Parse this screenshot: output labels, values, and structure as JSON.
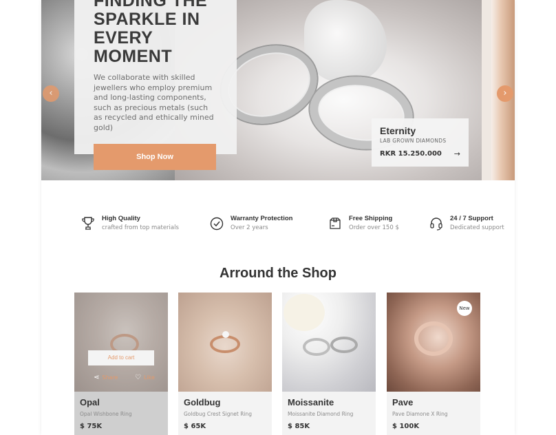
{
  "hero": {
    "title": "FINDING THE SPARKLE IN EVERY MOMENT",
    "description": "We collaborate with skilled jewellers who employ premium and long-lasting components, such as precious metals (such as recycled and ethically mined gold)",
    "shop_button": "Shop Now",
    "prev_arrow": "‹",
    "next_arrow": "›",
    "product": {
      "name": "Eternity",
      "subtitle": "LAB GROWN DIAMONDS",
      "price": "RKR 15.250.000",
      "arrow": "→"
    }
  },
  "features": [
    {
      "title": "High Quality",
      "subtitle": "crafted from top materials",
      "icon": "trophy-icon"
    },
    {
      "title": "Warranty Protection",
      "subtitle": "Over 2 years",
      "icon": "check-circle-icon"
    },
    {
      "title": "Free Shipping",
      "subtitle": "Order over 150 $",
      "icon": "shipping-box-icon"
    },
    {
      "title": "24 / 7 Support",
      "subtitle": "Dedicated support",
      "icon": "headset-icon"
    }
  ],
  "shop": {
    "title": "Arround the Shop",
    "add_to_cart": "Add to cart",
    "share": "Share",
    "like": "Like",
    "new_badge": "New",
    "products": [
      {
        "name": "Opal",
        "subtitle": "Opal Wishbone Ring",
        "price": "$ 75K"
      },
      {
        "name": "Goldbug",
        "subtitle": "Goldbug Crest Signet Ring",
        "price": "$ 65K"
      },
      {
        "name": "Moissanite",
        "subtitle": "Moissanite Diamond Ring",
        "price": "$ 85K"
      },
      {
        "name": "Pave",
        "subtitle": "Pave Diamone X Ring",
        "price": "$ 100K"
      }
    ]
  },
  "colors": {
    "accent": "#e49a6c",
    "text": "#333333",
    "muted": "#8a8a8a"
  }
}
